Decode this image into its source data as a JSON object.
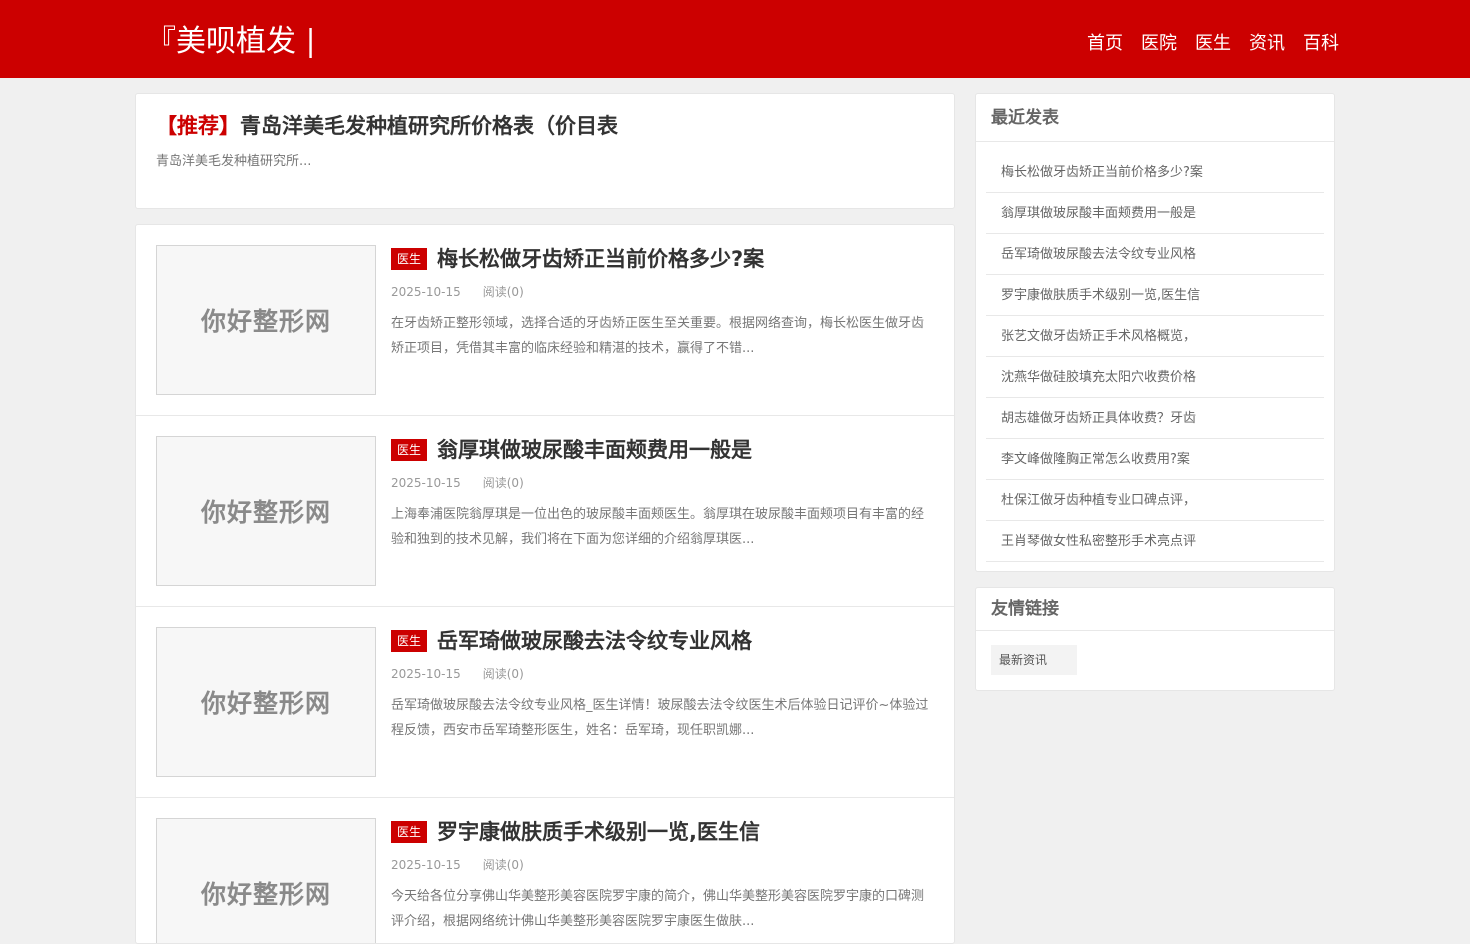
{
  "header": {
    "logo": "『美呗植发 |",
    "nav": [
      "首页",
      "医院",
      "医生",
      "资讯",
      "百科"
    ]
  },
  "featured": {
    "tag": "【推荐】",
    "title": "青岛洋美毛发种植研究所价格表（价目表",
    "desc": "青岛洋美毛发种植研究所..."
  },
  "posts": [
    {
      "thumb_text": "你好整形网",
      "category": "医生",
      "title": "梅长松做牙齿矫正当前价格多少?案",
      "date": "2025-10-15",
      "reads": "阅读(0)",
      "excerpt": "在牙齿矫正整形领域，选择合适的牙齿矫正医生至关重要。根据网络查询，梅长松医生做牙齿矫正项目，凭借其丰富的临床经验和精湛的技术，赢得了不错..."
    },
    {
      "thumb_text": "你好整形网",
      "category": "医生",
      "title": "翁厚琪做玻尿酸丰面颊费用一般是",
      "date": "2025-10-15",
      "reads": "阅读(0)",
      "excerpt": "上海奉浦医院翁厚琪是一位出色的玻尿酸丰面颊医生。翁厚琪在玻尿酸丰面颊项目有丰富的经验和独到的技术见解，我们将在下面为您详细的介绍翁厚琪医..."
    },
    {
      "thumb_text": "你好整形网",
      "category": "医生",
      "title": "岳军琦做玻尿酸去法令纹专业风格",
      "date": "2025-10-15",
      "reads": "阅读(0)",
      "excerpt": "岳军琦做玻尿酸去法令纹专业风格_医生详情！玻尿酸去法令纹医生术后体验日记评价~体验过程反馈，西安市岳军琦整形医生，姓名：岳军琦，现任职凯娜..."
    },
    {
      "thumb_text": "你好整形网",
      "category": "医生",
      "title": "罗宇康做肤质手术级别一览,医生信",
      "date": "2025-10-15",
      "reads": "阅读(0)",
      "excerpt": "今天给各位分享佛山华美整形美容医院罗宇康的简介，佛山华美整形美容医院罗宇康的口碑测评介绍，根据网络统计佛山华美整形美容医院罗宇康医生做肤..."
    }
  ],
  "sidebar": {
    "recent_title": "最近发表",
    "recent": [
      "梅长松做牙齿矫正当前价格多少?案",
      "翁厚琪做玻尿酸丰面颊费用一般是",
      "岳军琦做玻尿酸去法令纹专业风格",
      "罗宇康做肤质手术级别一览,医生信",
      "张艺文做牙齿矫正手术风格概览，",
      "沈燕华做硅胶填充太阳穴收费价格",
      "胡志雄做牙齿矫正具体收费？牙齿",
      "李文峰做隆胸正常怎么收费用?案",
      "杜保江做牙齿种植专业口碑点评，",
      "王肖琴做女性私密整形手术亮点评"
    ],
    "links_title": "友情链接",
    "links": [
      "最新资讯"
    ]
  },
  "colors": {
    "brand": "#cc0000",
    "background": "#f0f0f0"
  }
}
